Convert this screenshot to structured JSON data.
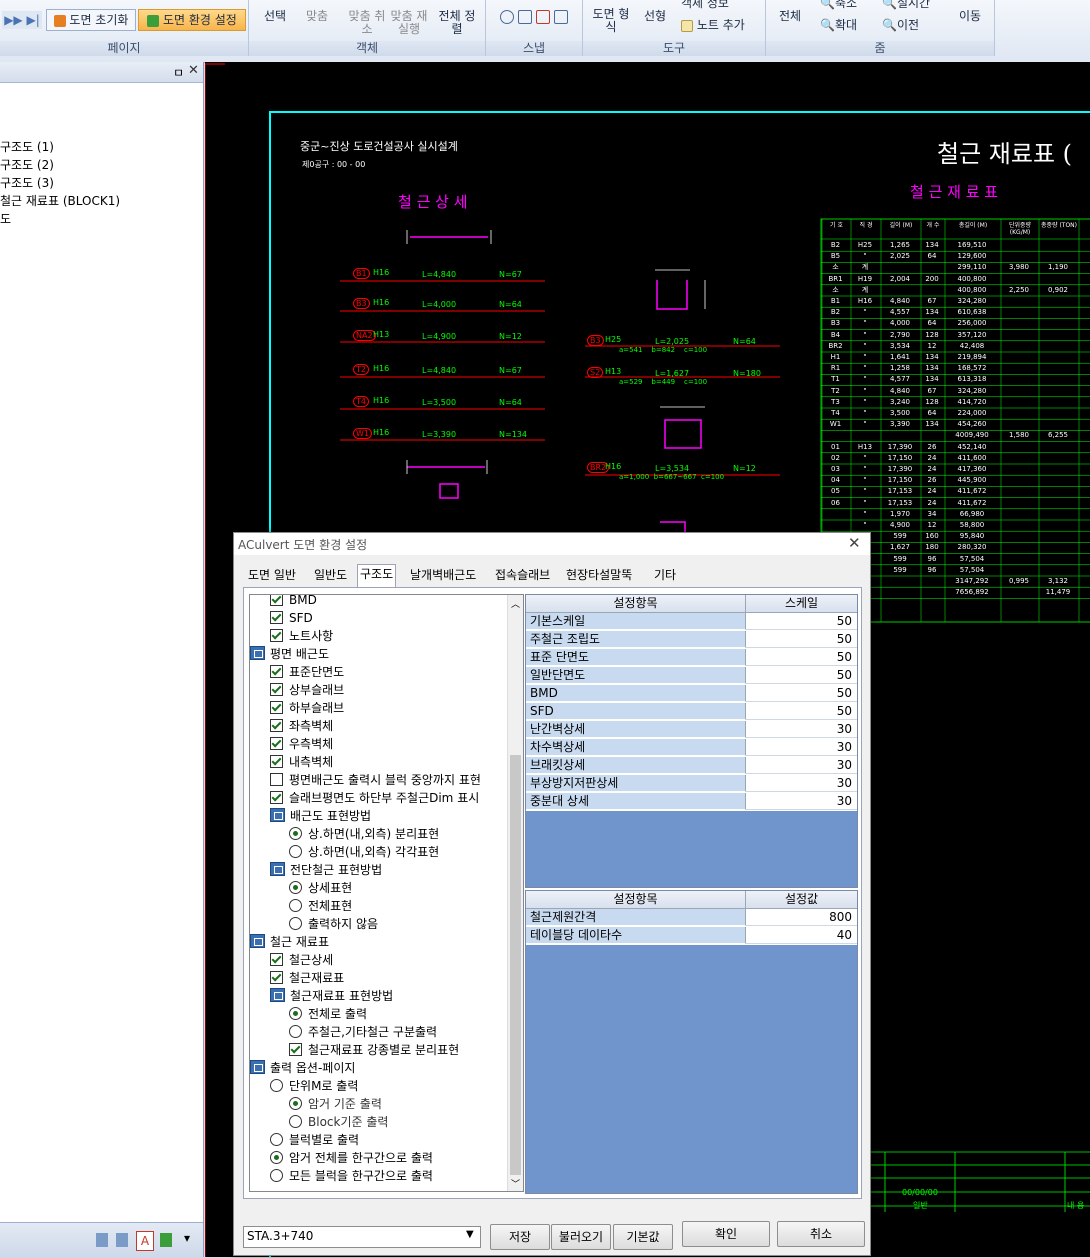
{
  "ribbon": {
    "page_group": {
      "label": "페이지",
      "init_label": "도면 초기화",
      "env_label": "도면 환경 설정"
    },
    "object_group": {
      "label": "객체",
      "select_label": "선택",
      "fit_label": "맞춤",
      "fit_cancel_label": "맞춤 취소",
      "fit_rerun_label": "맞춤 재실행",
      "arrange_all_label": "전체 정렬"
    },
    "snap_group": {
      "label": "스냅"
    },
    "tool_group": {
      "label": "도구",
      "drawing_form_label": "도면 형식",
      "select_label": "선형",
      "object_info_label": "객체 정보",
      "add_note_label": "노트 추가"
    },
    "zoom_group": {
      "label": "줌",
      "all_label": "전체",
      "zoom_out_label": "축소",
      "zoom_in_label": "확대",
      "realtime_label": "실시간",
      "prev_label": "이전",
      "move_label": "이동"
    }
  },
  "left_tree": {
    "items": [
      "구조도 (1)",
      "구조도 (2)",
      "구조도 (3)",
      "철근 재료표 (BLOCK1)",
      "도"
    ]
  },
  "cad": {
    "project_title": "중군~진상 도로건설공사 실시설계",
    "sub_title": "제0공구 : 00 - 00",
    "sheet_title": "철근 재료표 (",
    "detail_title": "철 근 상 세",
    "table_title": "철 근 재 료 표",
    "detail_rows": [
      {
        "mark": "B1",
        "dia": "H16",
        "len": "L=4,840",
        "num": "N=67"
      },
      {
        "mark": "B3",
        "dia": "H16",
        "len": "L=4,000",
        "num": "N=64"
      },
      {
        "mark": "NA2",
        "dia": "H13",
        "len": "L=4,900",
        "num": "N=12"
      },
      {
        "mark": "T2",
        "dia": "H16",
        "len": "L=4,840",
        "num": "N=67"
      },
      {
        "mark": "T4",
        "dia": "H16",
        "len": "L=3,500",
        "num": "N=64"
      },
      {
        "mark": "W1",
        "dia": "H16",
        "len": "L=3,390",
        "num": "N=134"
      }
    ],
    "mid_rows": [
      {
        "mark": "B3",
        "dia": "H25",
        "len": "L=2,025",
        "num": "N=64",
        "sub": "a=541    b=842    c=100"
      },
      {
        "mark": "S2",
        "dia": "H13",
        "len": "L=1,627",
        "num": "N=180",
        "sub": "a=529    b=449    c=100"
      },
      {
        "mark": "BR2",
        "dia": "H16",
        "len": "L=3,534",
        "num": "N=12",
        "sub": "a=1,000  b=667~667  c=100"
      }
    ],
    "table_headers": [
      "기 호",
      "직 경",
      "길이 (M)",
      "개 수",
      "총길이 (M)",
      "단위중량 (KG/M)",
      "총중량 (TON)"
    ],
    "table_rows": [
      [
        "B2",
        "H25",
        "1,265",
        "134",
        "169,510",
        "",
        ""
      ],
      [
        "B5",
        "\"",
        "2,025",
        "64",
        "129,600",
        "",
        ""
      ],
      [
        "소",
        "계",
        "",
        "",
        "299,110",
        "3,980",
        "1,190"
      ],
      [
        "BR1",
        "H19",
        "2,004",
        "200",
        "400,800",
        "",
        ""
      ],
      [
        "소",
        "계",
        "",
        "",
        "400,800",
        "2,250",
        "0,902"
      ],
      [
        "B1",
        "H16",
        "4,840",
        "67",
        "324,280",
        "",
        ""
      ],
      [
        "B2",
        "\"",
        "4,557",
        "134",
        "610,638",
        "",
        ""
      ],
      [
        "B3",
        "\"",
        "4,000",
        "64",
        "256,000",
        "",
        ""
      ],
      [
        "B4",
        "\"",
        "2,790",
        "128",
        "357,120",
        "",
        ""
      ],
      [
        "BR2",
        "\"",
        "3,534",
        "12",
        "42,408",
        "",
        ""
      ],
      [
        "H1",
        "\"",
        "1,641",
        "134",
        "219,894",
        "",
        ""
      ],
      [
        "R1",
        "\"",
        "1,258",
        "134",
        "168,572",
        "",
        ""
      ],
      [
        "T1",
        "\"",
        "4,577",
        "134",
        "613,318",
        "",
        ""
      ],
      [
        "T2",
        "\"",
        "4,840",
        "67",
        "324,280",
        "",
        ""
      ],
      [
        "T3",
        "\"",
        "3,240",
        "128",
        "414,720",
        "",
        ""
      ],
      [
        "T4",
        "\"",
        "3,500",
        "64",
        "224,000",
        "",
        ""
      ],
      [
        "W1",
        "\"",
        "3,390",
        "134",
        "454,260",
        "",
        ""
      ],
      [
        "",
        "",
        "",
        "",
        "4009,490",
        "1,580",
        "6,255"
      ],
      [
        "01",
        "H13",
        "17,390",
        "26",
        "452,140",
        "",
        ""
      ],
      [
        "02",
        "\"",
        "17,150",
        "24",
        "411,600",
        "",
        ""
      ],
      [
        "03",
        "\"",
        "17,390",
        "24",
        "417,360",
        "",
        ""
      ],
      [
        "04",
        "\"",
        "17,150",
        "26",
        "445,900",
        "",
        ""
      ],
      [
        "05",
        "\"",
        "17,153",
        "24",
        "411,672",
        "",
        ""
      ],
      [
        "06",
        "\"",
        "17,153",
        "24",
        "411,672",
        "",
        ""
      ],
      [
        "",
        "\"",
        "1,970",
        "34",
        "66,980",
        "",
        ""
      ],
      [
        "",
        "\"",
        "4,900",
        "12",
        "58,800",
        "",
        ""
      ],
      [
        "",
        "\"",
        "599",
        "160",
        "95,840",
        "",
        ""
      ],
      [
        "",
        "\"",
        "1,627",
        "180",
        "280,320",
        "",
        ""
      ],
      [
        "",
        "\"",
        "599",
        "96",
        "57,504",
        "",
        ""
      ],
      [
        "",
        "\"",
        "599",
        "96",
        "57,504",
        "",
        ""
      ],
      [
        "",
        "",
        "",
        "",
        "3147,292",
        "0,995",
        "3,132"
      ],
      [
        "",
        "",
        "",
        "",
        "7656,892",
        "",
        "11,479"
      ]
    ],
    "footer_date": "00/00/00",
    "footer_label1": "일반",
    "footer_label2": "내 용"
  },
  "dialog": {
    "title": "ACulvert 도면 환경 설정",
    "tabs": [
      "도면 일반",
      "일반도",
      "구조도",
      "날개벽배근도",
      "접속슬래브",
      "현장타설말뚝",
      "기타"
    ],
    "active_tab": "구조도",
    "tree": [
      {
        "type": "check",
        "on": true,
        "indent": 1,
        "label": "BMD"
      },
      {
        "type": "check",
        "on": true,
        "indent": 1,
        "label": "SFD"
      },
      {
        "type": "check",
        "on": true,
        "indent": 1,
        "label": "노트사항"
      },
      {
        "type": "group",
        "indent": 0,
        "label": "평면 배근도"
      },
      {
        "type": "check",
        "on": true,
        "indent": 1,
        "label": "표준단면도"
      },
      {
        "type": "check",
        "on": true,
        "indent": 1,
        "label": "상부슬래브"
      },
      {
        "type": "check",
        "on": true,
        "indent": 1,
        "label": "하부슬래브"
      },
      {
        "type": "check",
        "on": true,
        "indent": 1,
        "label": "좌측벽체"
      },
      {
        "type": "check",
        "on": true,
        "indent": 1,
        "label": "우측벽체"
      },
      {
        "type": "check",
        "on": true,
        "indent": 1,
        "label": "내측벽체"
      },
      {
        "type": "check",
        "on": false,
        "indent": 1,
        "label": "평면배근도 출력시 블럭 중앙까지 표현"
      },
      {
        "type": "check",
        "on": true,
        "indent": 1,
        "label": "슬래브평면도 하단부 주철근Dim 표시"
      },
      {
        "type": "group",
        "indent": 1,
        "label": "배근도 표현방법"
      },
      {
        "type": "radio",
        "on": true,
        "indent": 2,
        "label": "상.하면(내,외측) 분리표현"
      },
      {
        "type": "radio",
        "on": false,
        "indent": 2,
        "label": "상.하면(내,외측) 각각표현"
      },
      {
        "type": "group",
        "indent": 1,
        "label": "전단철근 표현방법"
      },
      {
        "type": "radio",
        "on": true,
        "indent": 2,
        "label": "상세표현"
      },
      {
        "type": "radio",
        "on": false,
        "indent": 2,
        "label": "전체표현"
      },
      {
        "type": "radio",
        "on": false,
        "indent": 2,
        "label": "출력하지 않음"
      },
      {
        "type": "group",
        "indent": 0,
        "label": "철근 재료표"
      },
      {
        "type": "check",
        "on": true,
        "indent": 1,
        "label": "철근상세"
      },
      {
        "type": "check",
        "on": true,
        "indent": 1,
        "label": "철근재료표"
      },
      {
        "type": "group",
        "indent": 1,
        "label": "철근재료표 표현방법"
      },
      {
        "type": "radio",
        "on": true,
        "indent": 2,
        "label": "전체로 출력"
      },
      {
        "type": "radio",
        "on": false,
        "indent": 2,
        "label": "주철근,기타철근 구분출력"
      },
      {
        "type": "check",
        "on": true,
        "indent": 2,
        "label": "철근재료표 강종별로 분리표현"
      },
      {
        "type": "group",
        "indent": 0,
        "label": "출력 옵션-페이지"
      },
      {
        "type": "radio",
        "on": false,
        "indent": 1,
        "label": "단위M로 출력"
      },
      {
        "type": "radio",
        "on": true,
        "indent": 2,
        "label": "암거 기준 출력",
        "dim": true
      },
      {
        "type": "radio",
        "on": false,
        "indent": 2,
        "label": "Block기준 출력",
        "dim": true
      },
      {
        "type": "radio",
        "on": false,
        "indent": 1,
        "label": "블럭별로 출력"
      },
      {
        "type": "radio",
        "on": true,
        "indent": 1,
        "label": "암거 전체를 한구간으로 출력"
      },
      {
        "type": "radio",
        "on": false,
        "indent": 1,
        "label": "모든 블럭을 한구간으로 출력"
      }
    ],
    "scale_table": {
      "headers": [
        "설정항목",
        "스케일"
      ],
      "rows": [
        [
          "기본스케일",
          "50"
        ],
        [
          "주철근 조립도",
          "50"
        ],
        [
          "표준 단면도",
          "50"
        ],
        [
          "일반단면도",
          "50"
        ],
        [
          "BMD",
          "50"
        ],
        [
          "SFD",
          "50"
        ],
        [
          "난간벽상세",
          "30"
        ],
        [
          "차수벽상세",
          "30"
        ],
        [
          "브래킷상세",
          "30"
        ],
        [
          "부상방지저판상세",
          "30"
        ],
        [
          "중분대 상세",
          "30"
        ]
      ]
    },
    "value_table": {
      "headers": [
        "설정항목",
        "설정값"
      ],
      "rows": [
        [
          "철근제원간격",
          "800"
        ],
        [
          "테이블당 데이타수",
          "40"
        ]
      ]
    },
    "station_value": "STA.3+740",
    "buttons": {
      "save": "저장",
      "load": "불러오기",
      "default": "기본값",
      "ok": "확인",
      "cancel": "취소"
    }
  },
  "colors": {
    "cad_bg": "#000000",
    "cad_frame": "#00ffff",
    "cad_text": "#ffffff",
    "cad_magenta": "#ff00ff",
    "cad_green": "#00ff00",
    "cad_red": "#ff0000",
    "grid_name_bg": "#c8daf0",
    "grid_blank": "#7095cd",
    "ribbon_highlight": "#f8b44a"
  }
}
